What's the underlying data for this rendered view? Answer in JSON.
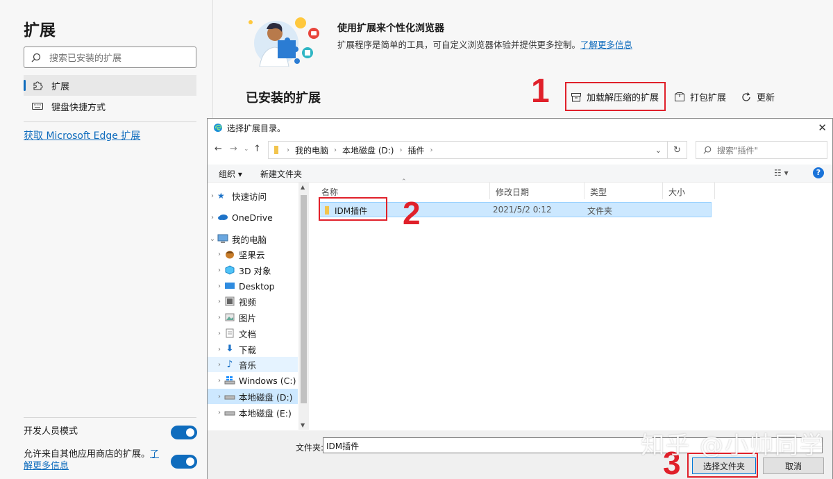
{
  "sidebar": {
    "title": "扩展",
    "search_placeholder": "搜索已安装的扩展",
    "items": [
      {
        "label": "扩展"
      },
      {
        "label": "键盘快捷方式"
      }
    ],
    "get_link": "获取 Microsoft Edge 扩展",
    "dev_mode_label": "开发人员模式",
    "allow_other_stores_label": "允许来自其他应用商店的扩展。",
    "learn_more_link": "了解更多信息"
  },
  "main": {
    "hero_title": "使用扩展来个性化浏览器",
    "hero_desc": "扩展程序是简单的工具，可自定义浏览器体验并提供更多控制。",
    "hero_link": "了解更多信息",
    "installed_title": "已安装的扩展",
    "actions": {
      "load_unpacked": "加载解压缩的扩展",
      "pack": "打包扩展",
      "update": "更新"
    }
  },
  "dialog": {
    "title": "选择扩展目录。",
    "breadcrumb": [
      "我的电脑",
      "本地磁盘 (D:)",
      "插件"
    ],
    "search_placeholder": "搜索\"插件\"",
    "organize": "组织 ▾",
    "new_folder": "新建文件夹",
    "tree": [
      {
        "label": "快速访问"
      },
      {
        "label": "OneDrive"
      },
      {
        "label": "我的电脑"
      },
      {
        "label": "坚果云"
      },
      {
        "label": "3D 对象"
      },
      {
        "label": "Desktop"
      },
      {
        "label": "视频"
      },
      {
        "label": "图片"
      },
      {
        "label": "文档"
      },
      {
        "label": "下载"
      },
      {
        "label": "音乐"
      },
      {
        "label": "Windows (C:)"
      },
      {
        "label": "本地磁盘 (D:)"
      },
      {
        "label": "本地磁盘 (E:)"
      }
    ],
    "columns": {
      "name": "名称",
      "date": "修改日期",
      "type": "类型",
      "size": "大小"
    },
    "file": {
      "name": "IDM插件",
      "date": "2021/5/2 0:12",
      "type": "文件夹"
    },
    "folder_label": "文件夹:",
    "folder_value": "IDM插件",
    "select_button": "选择文件夹",
    "cancel_button": "取消"
  },
  "annotations": {
    "n1": "1",
    "n2": "2",
    "n3": "3"
  },
  "watermark": "知乎 @小帅同学",
  "colors": {
    "accent": "#0f6cbd",
    "highlight": "#e0202a",
    "selection": "#cce8ff"
  }
}
